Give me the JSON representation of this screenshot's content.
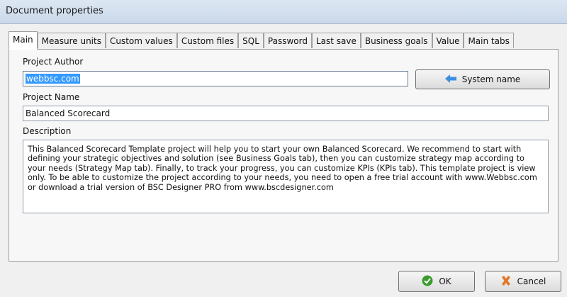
{
  "window": {
    "title": "Document properties"
  },
  "tabs": [
    {
      "label": "Main",
      "active": true
    },
    {
      "label": "Measure units",
      "active": false
    },
    {
      "label": "Custom values",
      "active": false
    },
    {
      "label": "Custom files",
      "active": false
    },
    {
      "label": "SQL",
      "active": false
    },
    {
      "label": "Password",
      "active": false
    },
    {
      "label": "Last save",
      "active": false
    },
    {
      "label": "Business goals",
      "active": false
    },
    {
      "label": "Value",
      "active": false
    },
    {
      "label": "Main tabs",
      "active": false
    }
  ],
  "main": {
    "author_label": "Project Author",
    "author_value": "webbsc.com",
    "system_name_button": "System name",
    "name_label": "Project Name",
    "name_value": "Balanced Scorecard",
    "description_label": "Description",
    "description_value": "This Balanced Scorecard Template project will help you to start your own Balanced Scorecard.   We recommend to start with defining your strategic objectives and solution (see Business Goals tab), then you can customize strategy map according to your needs (Strategy Map tab). Finally, to track your progress, you can customize KPIs (KPIs tab).  This template project is view only.  To be able to customize the project according to your needs, you need to open a free trial account with www.Webbsc.com or download a trial version of BSC Designer PRO from www.bscdesigner.com"
  },
  "footer": {
    "ok_label": "OK",
    "cancel_label": "Cancel"
  },
  "colors": {
    "selection": "#3399ff",
    "title_bar": "#c9d8ea",
    "ok_icon": "#3a9b2e",
    "cancel_icon": "#e0772a",
    "arrow_icon": "#3b8fe0"
  }
}
